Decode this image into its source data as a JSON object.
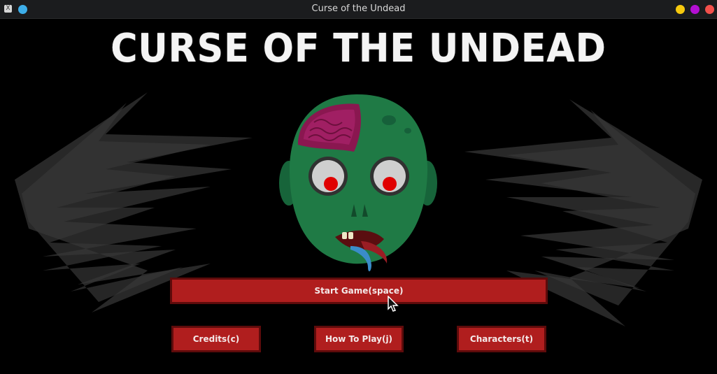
{
  "window": {
    "title": "Curse of the Undead",
    "app_icon": "X",
    "pin_icon": "circle-icon",
    "min_icon": "yellow-circle-icon",
    "max_icon": "purple-circle-icon",
    "close_icon": "red-circle-icon"
  },
  "game": {
    "title": "CURSE OF THE UNDEAD",
    "colors": {
      "background": "#000000",
      "button_fill": "#b01e1e",
      "button_border": "#5e0b0b",
      "zombie_skin": "#1f7a45",
      "zombie_eye_pupil": "#e00000"
    }
  },
  "menu": {
    "start": "Start Game(space)",
    "credits": "Credits(c)",
    "how_to_play": "How To Play(j)",
    "characters": "Characters(t)"
  }
}
